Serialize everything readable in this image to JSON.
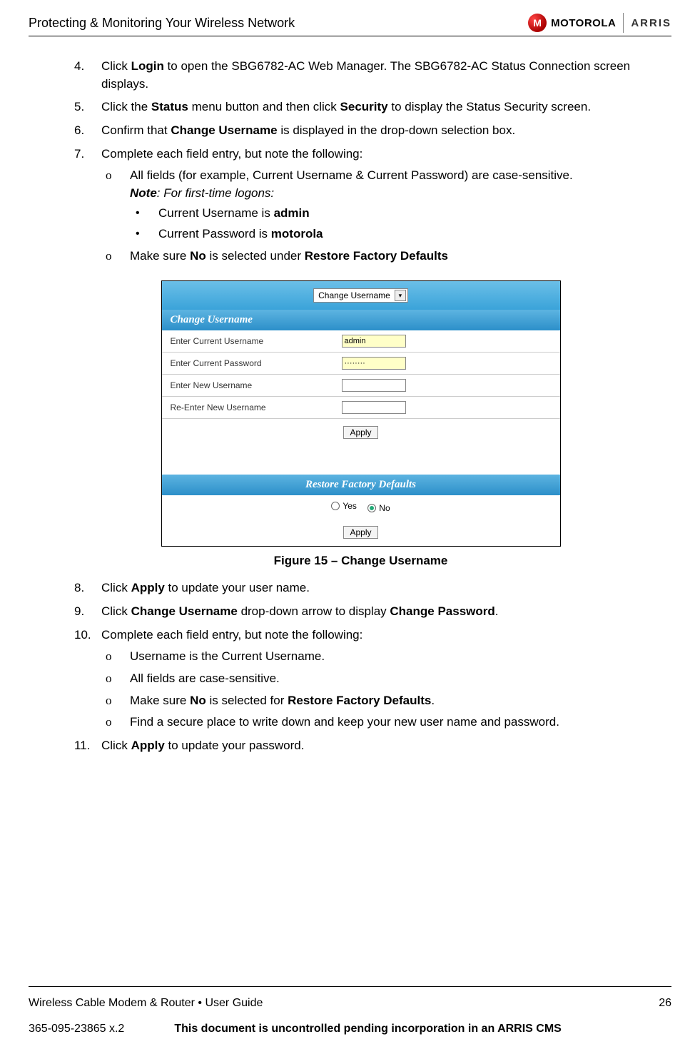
{
  "header": {
    "title": "Protecting & Monitoring Your Wireless Network",
    "logo1": "MOTOROLA",
    "logo2": "ARRIS"
  },
  "steps": {
    "s4": {
      "num": "4.",
      "pre": "Click ",
      "b1": "Login",
      "post": " to open the SBG6782-AC Web Manager. The SBG6782-AC Status Connection screen displays."
    },
    "s5": {
      "num": "5.",
      "pre": "Click the ",
      "b1": "Status",
      "mid": " menu button and then click ",
      "b2": "Security",
      "post": " to display the Status Security screen."
    },
    "s6": {
      "num": "6.",
      "pre": "Confirm that ",
      "b1": "Change Username",
      "post": " is displayed in the drop-down selection box."
    },
    "s7": {
      "num": "7.",
      "text": "Complete each field entry, but note the following:",
      "sub_a": "All fields (for example, Current Username & Current Password) are case-sensitive.",
      "note_b": "Note",
      "note_rest": ": For first-time logons:",
      "bullet1_pre": "Current Username is ",
      "bullet1_b": "admin",
      "bullet2_pre": "Current Password is ",
      "bullet2_b": "motorola",
      "sub_b_pre": "Make sure ",
      "sub_b_b1": "No",
      "sub_b_mid": " is selected under ",
      "sub_b_b2": "Restore Factory Defaults"
    },
    "s8": {
      "num": "8.",
      "pre": "Click ",
      "b1": "Apply",
      "post": " to update your user name."
    },
    "s9": {
      "num": "9.",
      "pre": "Click ",
      "b1": "Change Username",
      "mid": " drop-down arrow to display ",
      "b2": "Change Password",
      "post": "."
    },
    "s10": {
      "num": "10.",
      "text": "Complete each field entry, but note the following:",
      "a": "Username is the Current Username.",
      "b": "All fields are case-sensitive.",
      "c_pre": "Make sure ",
      "c_b1": "No",
      "c_mid": " is selected for ",
      "c_b2": "Restore Factory Defaults",
      "c_post": ".",
      "d": "Find a secure place to write down and keep your new user name and password."
    },
    "s11": {
      "num": "11.",
      "pre": "Click ",
      "b1": "Apply",
      "post": " to update your password."
    }
  },
  "figure": {
    "caption": "Figure 15 – Change Username",
    "dropdown": "Change Username",
    "section1": "Change Username",
    "row1": "Enter Current Username",
    "row1_val": "admin",
    "row2": "Enter Current Password",
    "row2_val": "········",
    "row3": "Enter New Username",
    "row4": "Re-Enter New Username",
    "apply": "Apply",
    "section2": "Restore Factory Defaults",
    "yes": "Yes",
    "no": "No"
  },
  "footer": {
    "guide": "Wireless Cable Modem & Router • User Guide",
    "page": "26",
    "docnum": "365-095-23865 x.2",
    "notice": "This document is uncontrolled pending incorporation in an ARRIS CMS"
  }
}
